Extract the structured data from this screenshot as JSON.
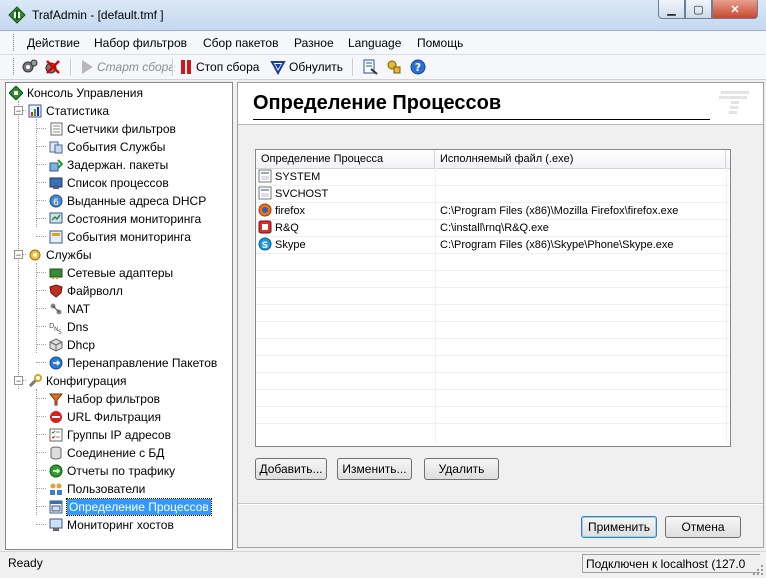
{
  "window": {
    "title": "TrafAdmin - [default.tmf ]"
  },
  "menu": [
    "Действие",
    "Набор фильтров",
    "Сбор пакетов",
    "Разное",
    "Language",
    "Помощь"
  ],
  "toolbar": {
    "start_label": "Старт сбора",
    "stop_label": "Стоп сбора",
    "reset_label": "Обнулить"
  },
  "tree": {
    "root": "Консоль Управления",
    "stats": {
      "label": "Статистика",
      "items": [
        "Счетчики фильтров",
        "События Службы",
        "Задержан. пакеты",
        "Список процессов",
        "Выданные адреса DHCP",
        "Состояния мониторинга",
        "События мониторинга"
      ]
    },
    "services": {
      "label": "Службы",
      "items": [
        "Сетевые адаптеры",
        "Файрволл",
        "NAT",
        "Dns",
        "Dhcp",
        "Перенаправление Пакетов"
      ]
    },
    "config": {
      "label": "Конфигурация",
      "items": [
        "Набор фильтров",
        "URL Фильтрация",
        "Группы IP адресов",
        "Соединение с БД",
        "Отчеты по трафику",
        "Пользователи",
        "Определение Процессов",
        "Мониторинг хостов"
      ]
    }
  },
  "panel": {
    "title": "Определение Процессов",
    "columns": [
      "Определение Процесса",
      "Исполняемый файл (.exe)"
    ],
    "rows": [
      {
        "name": "SYSTEM",
        "exe": "",
        "icon": "system-process-icon"
      },
      {
        "name": "SVCHOST",
        "exe": "",
        "icon": "svchost-process-icon"
      },
      {
        "name": "firefox",
        "exe": "C:\\Program Files (x86)\\Mozilla Firefox\\firefox.exe",
        "icon": "firefox-icon"
      },
      {
        "name": "R&Q",
        "exe": "C:\\install\\rnq\\R&Q.exe",
        "icon": "rnq-icon"
      },
      {
        "name": "Skype",
        "exe": "C:\\Program Files (x86)\\Skype\\Phone\\Skype.exe",
        "icon": "skype-icon"
      }
    ],
    "buttons": {
      "add": "Добавить...",
      "edit": "Изменить...",
      "delete": "Удалить",
      "apply": "Применить",
      "cancel": "Отмена"
    }
  },
  "status": {
    "left": "Ready",
    "right": "Подключен к localhost (127.0"
  },
  "colors": {
    "selection": "#3399ff",
    "titlebar": "#c4d8ef"
  }
}
